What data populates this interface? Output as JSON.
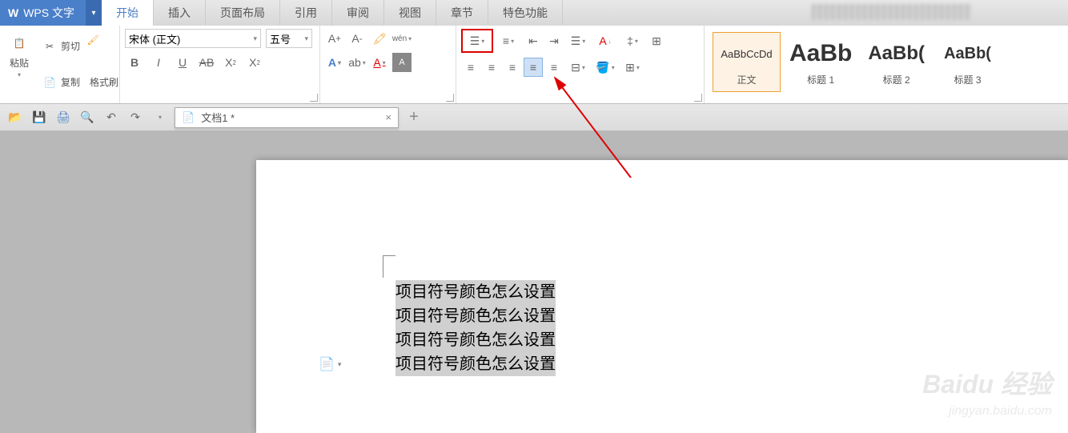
{
  "app": {
    "name": "WPS 文字",
    "logo": "W"
  },
  "menuTabs": [
    "开始",
    "插入",
    "页面布局",
    "引用",
    "审阅",
    "视图",
    "章节",
    "特色功能"
  ],
  "activeTab": 0,
  "clipboard": {
    "paste": "粘贴",
    "cut": "剪切",
    "copy": "复制",
    "format_painter": "格式刷"
  },
  "font": {
    "family": "宋体 (正文)",
    "size": "五号",
    "bold": "B",
    "italic": "I",
    "underline": "U",
    "strike": "ᴬᴮ",
    "super": "X²",
    "sub": "X₂",
    "ab": "AB"
  },
  "para": {
    "bullets": "≡",
    "numbering": "≡",
    "indent_dec": "≡",
    "indent_inc": "≡",
    "align_left": "≡",
    "align_center": "≡",
    "align_right": "≡",
    "justify": "≡",
    "distribute": "≡"
  },
  "styles": [
    {
      "preview": "AaBbCcDd",
      "label": "正文",
      "cls": ""
    },
    {
      "preview": "AaBb",
      "label": "标题 1",
      "cls": "big"
    },
    {
      "preview": "AaBb(",
      "label": "标题 2",
      "cls": "big2"
    },
    {
      "preview": "AaBb(",
      "label": "标题 3",
      "cls": "big3"
    }
  ],
  "qat": {
    "doc_tab": "文档1 *"
  },
  "document": {
    "lines": [
      "项目符号颜色怎么设置",
      "项目符号颜色怎么设置",
      "项目符号颜色怎么设置",
      "项目符号颜色怎么设置"
    ]
  },
  "watermark": {
    "main": "Baidu 经验",
    "sub": "jingyan.baidu.com"
  }
}
